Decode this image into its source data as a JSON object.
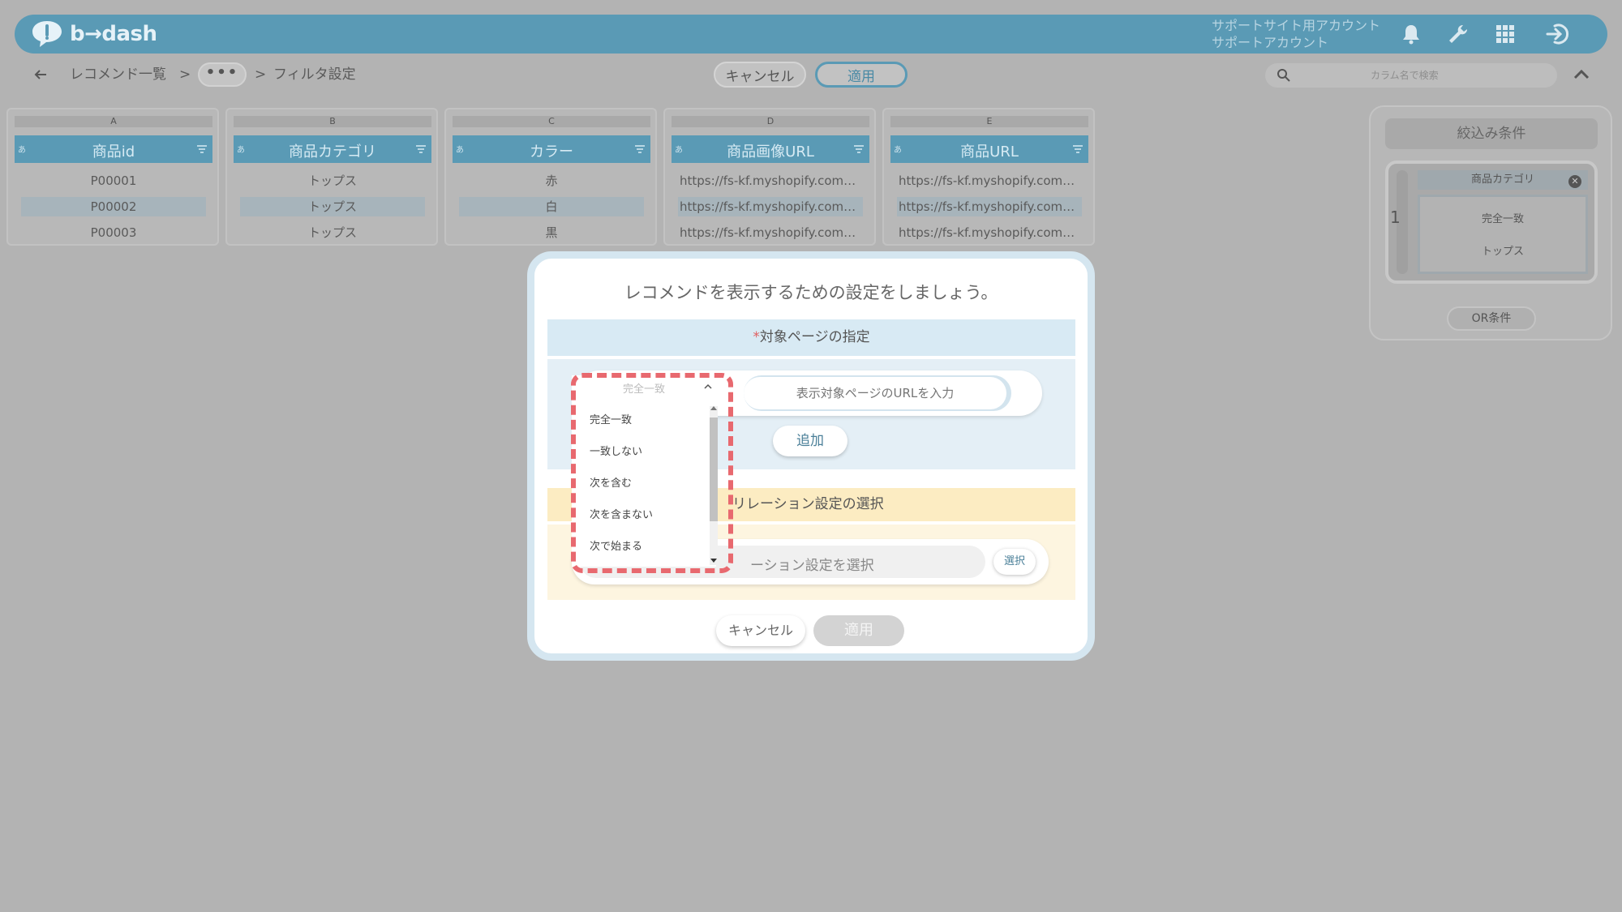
{
  "header": {
    "logo_text": "b→dash",
    "account_line1": "サポートサイト用アカウント",
    "account_line2": "サポートアカウント",
    "icons": [
      "bell-icon",
      "wrench-icon",
      "grid-icon",
      "logout-icon"
    ]
  },
  "breadcrumb": {
    "item1": "レコメンド一覧",
    "sep1": ">",
    "more": "•••",
    "sep2": ">",
    "item2": "フィルタ設定"
  },
  "toolbar": {
    "cancel_label": "キャンセル",
    "apply_label": "適用",
    "search_placeholder": "カラム名で検索"
  },
  "columns": [
    {
      "letter": "A",
      "type": "あ",
      "name": "商品id",
      "cells": [
        "P00001",
        "P00002",
        "P00003"
      ]
    },
    {
      "letter": "B",
      "type": "あ",
      "name": "商品カテゴリ",
      "cells": [
        "トップス",
        "トップス",
        "トップス"
      ]
    },
    {
      "letter": "C",
      "type": "あ",
      "name": "カラー",
      "cells": [
        "赤",
        "白",
        "黒"
      ]
    },
    {
      "letter": "D",
      "type": "あ",
      "name": "商品画像URL",
      "cells": [
        "https://fs-kf.myshopify.com…",
        "https://fs-kf.myshopify.com…",
        "https://fs-kf.myshopify.com…"
      ]
    },
    {
      "letter": "E",
      "type": "あ",
      "name": "商品URL",
      "cells": [
        "https://fs-kf.myshopify.com…",
        "https://fs-kf.myshopify.com…",
        "https://fs-kf.myshopify.com…"
      ]
    }
  ],
  "filter_panel": {
    "title": "絞込み条件",
    "group_number": "1",
    "tag": "商品カテゴリ",
    "match_type": "完全一致",
    "value": "トップス",
    "or_label": "OR条件"
  },
  "modal": {
    "title": "レコメンドを表示するための設定をしましょう。",
    "section1": {
      "required_mark": "*",
      "title": "対象ページの指定"
    },
    "url_placeholder": "表示対象ページのURLを入力",
    "add_label": "追加",
    "section2_title": "リレーション設定の選択",
    "relation_placeholder": "ーション設定を選択",
    "select_label": "選択",
    "cancel_label": "キャンセル",
    "apply_label": "適用",
    "dropdown": {
      "selected": "完全一致",
      "options": [
        "完全一致",
        "一致しない",
        "次を含む",
        "次を含まない",
        "次で始まる"
      ]
    }
  },
  "colors": {
    "accent": "#5a9ab5",
    "highlight": "#e8696f",
    "section1_bg": "#d8eaf4",
    "section2_bg": "#fcecc2"
  }
}
